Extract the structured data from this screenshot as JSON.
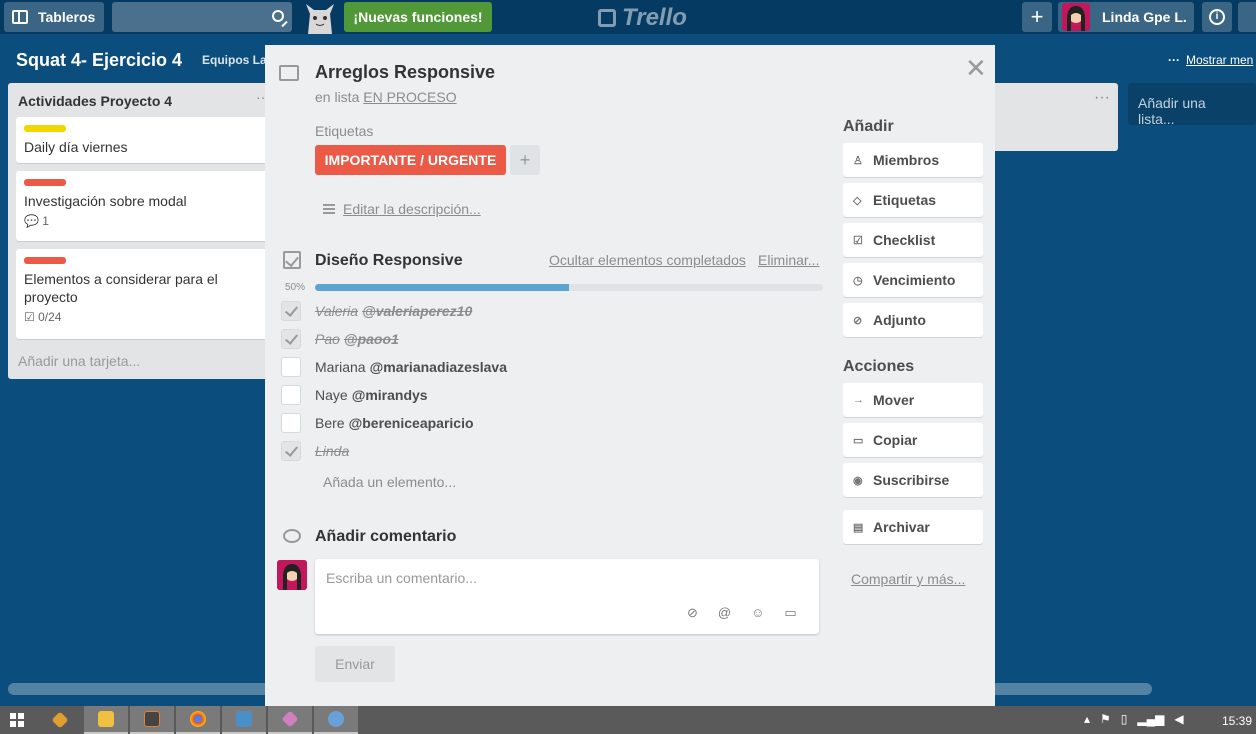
{
  "header": {
    "boards_label": "Tableros",
    "search_value": "",
    "new_features_label": "¡Nuevas funciones!",
    "logo_text": "Trello",
    "user_name": "Linda Gpe L."
  },
  "board": {
    "title": "Squat 4- Ejercicio 4",
    "team": "Equipos La",
    "menu_dots": "···",
    "show_menu": "Mostrar men"
  },
  "lists": [
    {
      "title": "Actividades Proyecto 4",
      "cards": [
        {
          "label_color": "#f2d600",
          "title": "Daily día viernes",
          "meta": ""
        },
        {
          "label_color": "#eb5a46",
          "title": "Investigación sobre modal",
          "meta": "1"
        },
        {
          "label_color": "#eb5a46",
          "title": "Elementos a considerar para el proyecto",
          "meta": "0/24"
        }
      ],
      "add_card": "Añadir una tarjeta..."
    }
  ],
  "add_list": "Añadir una lista...",
  "modal": {
    "title": "Arreglos Responsive",
    "in_list_prefix": "en lista",
    "in_list_name": "EN PROCESO",
    "labels_heading": "Etiquetas",
    "label_text": "IMPORTANTE / URGENTE",
    "label_color": "#eb5a46",
    "add_label": "+",
    "edit_description": "Editar la descripción...",
    "checklist": {
      "title": "Diseño Responsive",
      "hide_completed": "Ocultar elementos completados",
      "delete": "Eliminar...",
      "progress_label": "50%",
      "progress": 0.5,
      "items": [
        {
          "name": "Valeria",
          "mention": "@valeriaperez10",
          "done": true
        },
        {
          "name": "Pao",
          "mention": "@paoo1",
          "done": true
        },
        {
          "name": "Mariana",
          "mention": "@marianadiazeslava",
          "done": false
        },
        {
          "name": "Naye",
          "mention": "@mirandys",
          "done": false
        },
        {
          "name": "Bere",
          "mention": "@bereniceaparicio",
          "done": false
        },
        {
          "name": "Linda",
          "mention": "",
          "done": true
        }
      ],
      "add_item": "Añada un elemento..."
    },
    "comment": {
      "heading": "Añadir comentario",
      "placeholder": "Escriba un comentario...",
      "send": "Enviar"
    },
    "sidebar": {
      "add_heading": "Añadir",
      "add_buttons": [
        {
          "label": "Miembros",
          "icon": "person-icon"
        },
        {
          "label": "Etiquetas",
          "icon": "tag-icon"
        },
        {
          "label": "Checklist",
          "icon": "checkbox-icon"
        },
        {
          "label": "Vencimiento",
          "icon": "clock-icon"
        },
        {
          "label": "Adjunto",
          "icon": "paperclip-icon"
        }
      ],
      "actions_heading": "Acciones",
      "action_buttons": [
        {
          "label": "Mover",
          "icon": "arrow-right-icon"
        },
        {
          "label": "Copiar",
          "icon": "card-icon"
        },
        {
          "label": "Suscribirse",
          "icon": "eye-icon"
        },
        {
          "label": "Archivar",
          "icon": "archive-icon"
        }
      ],
      "share": "Compartir y más..."
    }
  },
  "taskbar": {
    "clock": "15:39"
  }
}
